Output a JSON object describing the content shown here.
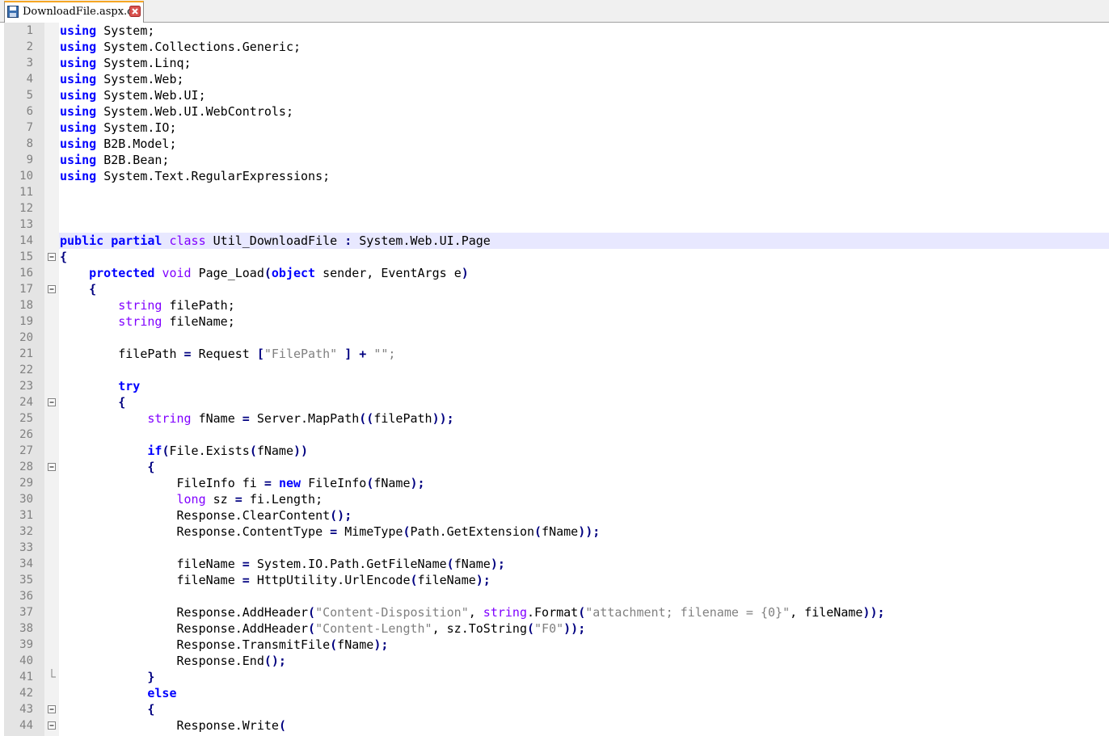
{
  "tab": {
    "label": "DownloadFile.aspx.cs",
    "icon": "floppy-disk-icon",
    "close_icon": "close-x-icon"
  },
  "editor": {
    "current_line": 14,
    "lines": [
      {
        "n": "1",
        "t": [
          [
            "kw",
            "using"
          ],
          [
            "",
            "System;"
          ]
        ]
      },
      {
        "n": "2",
        "t": [
          [
            "kw",
            "using"
          ],
          [
            "",
            "System.Collections.Generic;"
          ]
        ]
      },
      {
        "n": "3",
        "t": [
          [
            "kw",
            "using"
          ],
          [
            "",
            "System.Linq;"
          ]
        ]
      },
      {
        "n": "4",
        "t": [
          [
            "kw",
            "using"
          ],
          [
            "",
            "System.Web;"
          ]
        ]
      },
      {
        "n": "5",
        "t": [
          [
            "kw",
            "using"
          ],
          [
            "",
            "System.Web.UI;"
          ]
        ]
      },
      {
        "n": "6",
        "t": [
          [
            "kw",
            "using"
          ],
          [
            "",
            "System.Web.UI.WebControls;"
          ]
        ]
      },
      {
        "n": "7",
        "t": [
          [
            "kw",
            "using"
          ],
          [
            "",
            "System.IO;"
          ]
        ]
      },
      {
        "n": "8",
        "t": [
          [
            "kw",
            "using"
          ],
          [
            "",
            "B2B.Model;"
          ]
        ]
      },
      {
        "n": "9",
        "t": [
          [
            "kw",
            "using"
          ],
          [
            "",
            "B2B.Bean;"
          ]
        ]
      },
      {
        "n": "10",
        "t": [
          [
            "kw",
            "using"
          ],
          [
            "",
            "System.Text.RegularExpressions;"
          ]
        ]
      },
      {
        "n": "11",
        "t": []
      },
      {
        "n": "12",
        "t": []
      },
      {
        "n": "13",
        "t": []
      },
      {
        "n": "14",
        "t": [
          [
            "kw",
            "public"
          ],
          [
            "kw",
            "partial"
          ],
          [
            "ty",
            "class"
          ],
          [
            "",
            "Util_DownloadFile"
          ],
          [
            "op",
            ":"
          ],
          [
            "",
            "System.Web.UI.Page"
          ]
        ]
      },
      {
        "n": "15",
        "fold": "box",
        "t": [
          [
            "op",
            "{"
          ]
        ]
      },
      {
        "n": "16",
        "t": [
          [
            "kw",
            "    protected"
          ],
          [
            "ty",
            "void"
          ],
          [
            "",
            "Page_Load"
          ],
          [
            "op",
            "("
          ],
          [
            "kw",
            "object"
          ],
          [
            "",
            "sender,"
          ],
          [
            "",
            "EventArgs"
          ],
          [
            "",
            "e"
          ],
          [
            "op",
            ")"
          ]
        ]
      },
      {
        "n": "17",
        "fold": "box",
        "t": [
          [
            "op",
            "    {"
          ]
        ]
      },
      {
        "n": "18",
        "t": [
          [
            "ty",
            "        string"
          ],
          [
            "",
            "filePath;"
          ]
        ]
      },
      {
        "n": "19",
        "t": [
          [
            "ty",
            "        string"
          ],
          [
            "",
            "fileName;"
          ]
        ]
      },
      {
        "n": "20",
        "t": []
      },
      {
        "n": "21",
        "t": [
          [
            "",
            "        filePath"
          ],
          [
            "op",
            "="
          ],
          [
            "",
            "Request"
          ],
          [
            "op",
            "["
          ],
          [
            "st",
            "\"FilePath\""
          ],
          [
            "op",
            "]"
          ],
          [
            "op",
            "+"
          ],
          [
            "st",
            "\"\";"
          ]
        ]
      },
      {
        "n": "22",
        "t": []
      },
      {
        "n": "23",
        "t": [
          [
            "kw",
            "        try"
          ]
        ]
      },
      {
        "n": "24",
        "fold": "box",
        "t": [
          [
            "op",
            "        {"
          ]
        ]
      },
      {
        "n": "25",
        "t": [
          [
            "ty",
            "            string"
          ],
          [
            "",
            "fName"
          ],
          [
            "op",
            "="
          ],
          [
            "",
            "Server.MapPath"
          ],
          [
            "op",
            "(("
          ],
          [
            "",
            "filePath"
          ],
          [
            "op",
            "));"
          ]
        ]
      },
      {
        "n": "26",
        "t": []
      },
      {
        "n": "27",
        "t": [
          [
            "kw",
            "            if"
          ],
          [
            "op",
            "("
          ],
          [
            "",
            "File.Exists"
          ],
          [
            "op",
            "("
          ],
          [
            "",
            "fName"
          ],
          [
            "op",
            "))"
          ]
        ]
      },
      {
        "n": "28",
        "fold": "box",
        "t": [
          [
            "op",
            "            {"
          ]
        ]
      },
      {
        "n": "29",
        "t": [
          [
            "",
            "                FileInfo fi"
          ],
          [
            "op",
            "="
          ],
          [
            "kw",
            "new"
          ],
          [
            "",
            "FileInfo"
          ],
          [
            "op",
            "("
          ],
          [
            "",
            "fName"
          ],
          [
            "op",
            ");"
          ]
        ]
      },
      {
        "n": "30",
        "t": [
          [
            "ty",
            "                long"
          ],
          [
            "",
            "sz"
          ],
          [
            "op",
            "="
          ],
          [
            "",
            "fi.Length;"
          ]
        ]
      },
      {
        "n": "31",
        "t": [
          [
            "",
            "                Response.ClearContent"
          ],
          [
            "op",
            "();"
          ]
        ]
      },
      {
        "n": "32",
        "t": [
          [
            "",
            "                Response.ContentType"
          ],
          [
            "op",
            "="
          ],
          [
            "",
            "MimeType"
          ],
          [
            "op",
            "("
          ],
          [
            "",
            "Path.GetExtension"
          ],
          [
            "op",
            "("
          ],
          [
            "",
            "fName"
          ],
          [
            "op",
            "));"
          ]
        ]
      },
      {
        "n": "33",
        "t": []
      },
      {
        "n": "34",
        "t": [
          [
            "",
            "                fileName"
          ],
          [
            "op",
            "="
          ],
          [
            "",
            "System.IO.Path.GetFileName"
          ],
          [
            "op",
            "("
          ],
          [
            "",
            "fName"
          ],
          [
            "op",
            ");"
          ]
        ]
      },
      {
        "n": "35",
        "t": [
          [
            "",
            "                fileName"
          ],
          [
            "op",
            "="
          ],
          [
            "",
            "HttpUtility.UrlEncode"
          ],
          [
            "op",
            "("
          ],
          [
            "",
            "fileName"
          ],
          [
            "op",
            ");"
          ]
        ]
      },
      {
        "n": "36",
        "t": []
      },
      {
        "n": "37",
        "t": [
          [
            "",
            "                Response.AddHeader"
          ],
          [
            "op",
            "("
          ],
          [
            "st",
            "\"Content-Disposition\""
          ],
          [
            "",
            ","
          ],
          [
            "ty",
            "string"
          ],
          [
            "",
            ".Format"
          ],
          [
            "op",
            "("
          ],
          [
            "st",
            "\"attachment; filename = {0}\""
          ],
          [
            "",
            ", fileName"
          ],
          [
            "op",
            "));"
          ]
        ]
      },
      {
        "n": "38",
        "t": [
          [
            "",
            "                Response.AddHeader"
          ],
          [
            "op",
            "("
          ],
          [
            "st",
            "\"Content-Length\""
          ],
          [
            "",
            ", sz.ToString"
          ],
          [
            "op",
            "("
          ],
          [
            "st",
            "\"F0\""
          ],
          [
            "op",
            "));"
          ]
        ]
      },
      {
        "n": "39",
        "t": [
          [
            "",
            "                Response.TransmitFile"
          ],
          [
            "op",
            "("
          ],
          [
            "",
            "fName"
          ],
          [
            "op",
            ");"
          ]
        ]
      },
      {
        "n": "40",
        "t": [
          [
            "",
            "                Response.End"
          ],
          [
            "op",
            "();"
          ]
        ]
      },
      {
        "n": "41",
        "fold": "end",
        "t": [
          [
            "op",
            "            }"
          ]
        ]
      },
      {
        "n": "42",
        "t": [
          [
            "kw",
            "            else"
          ]
        ]
      },
      {
        "n": "43",
        "fold": "box",
        "t": [
          [
            "op",
            "            {"
          ]
        ]
      },
      {
        "n": "44",
        "fold": "box",
        "t": [
          [
            "",
            "                Response.Write"
          ],
          [
            "op",
            "("
          ]
        ]
      }
    ]
  }
}
